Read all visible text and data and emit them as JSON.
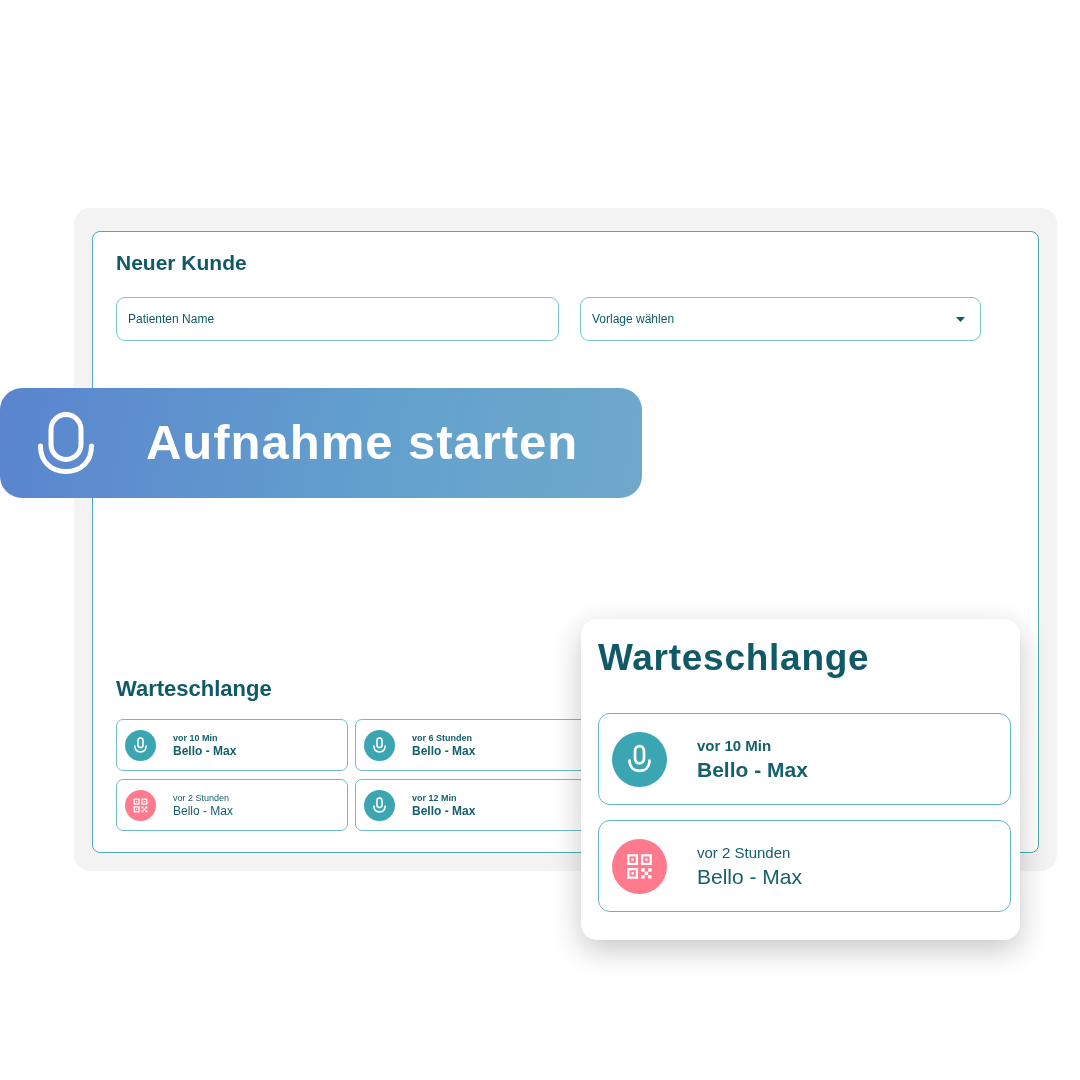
{
  "new_customer": {
    "title": "Neuer Kunde",
    "name_field": {
      "placeholder": "Patienten Name"
    },
    "template_select": {
      "placeholder": "Vorlage wählen"
    }
  },
  "record_button": {
    "label": "Aufnahme starten"
  },
  "queue": {
    "title": "Warteschlange",
    "items": [
      {
        "kind": "recording",
        "time": "vor 10 Min",
        "name": "Bello - Max"
      },
      {
        "kind": "recording",
        "time": "vor 6 Stunden",
        "name": "Bello - Max"
      },
      {
        "kind": "qr",
        "time": "vor 2 Stunden",
        "name": "Bello - Max"
      },
      {
        "kind": "recording",
        "time": "vor 12 Min",
        "name": "Bello - Max"
      }
    ]
  },
  "queue_popup": {
    "title": "Warteschlange",
    "items": [
      {
        "kind": "recording",
        "time": "vor 10 Min",
        "name": "Bello - Max"
      },
      {
        "kind": "qr",
        "time": "vor 2 Stunden",
        "name": "Bello - Max"
      }
    ]
  }
}
